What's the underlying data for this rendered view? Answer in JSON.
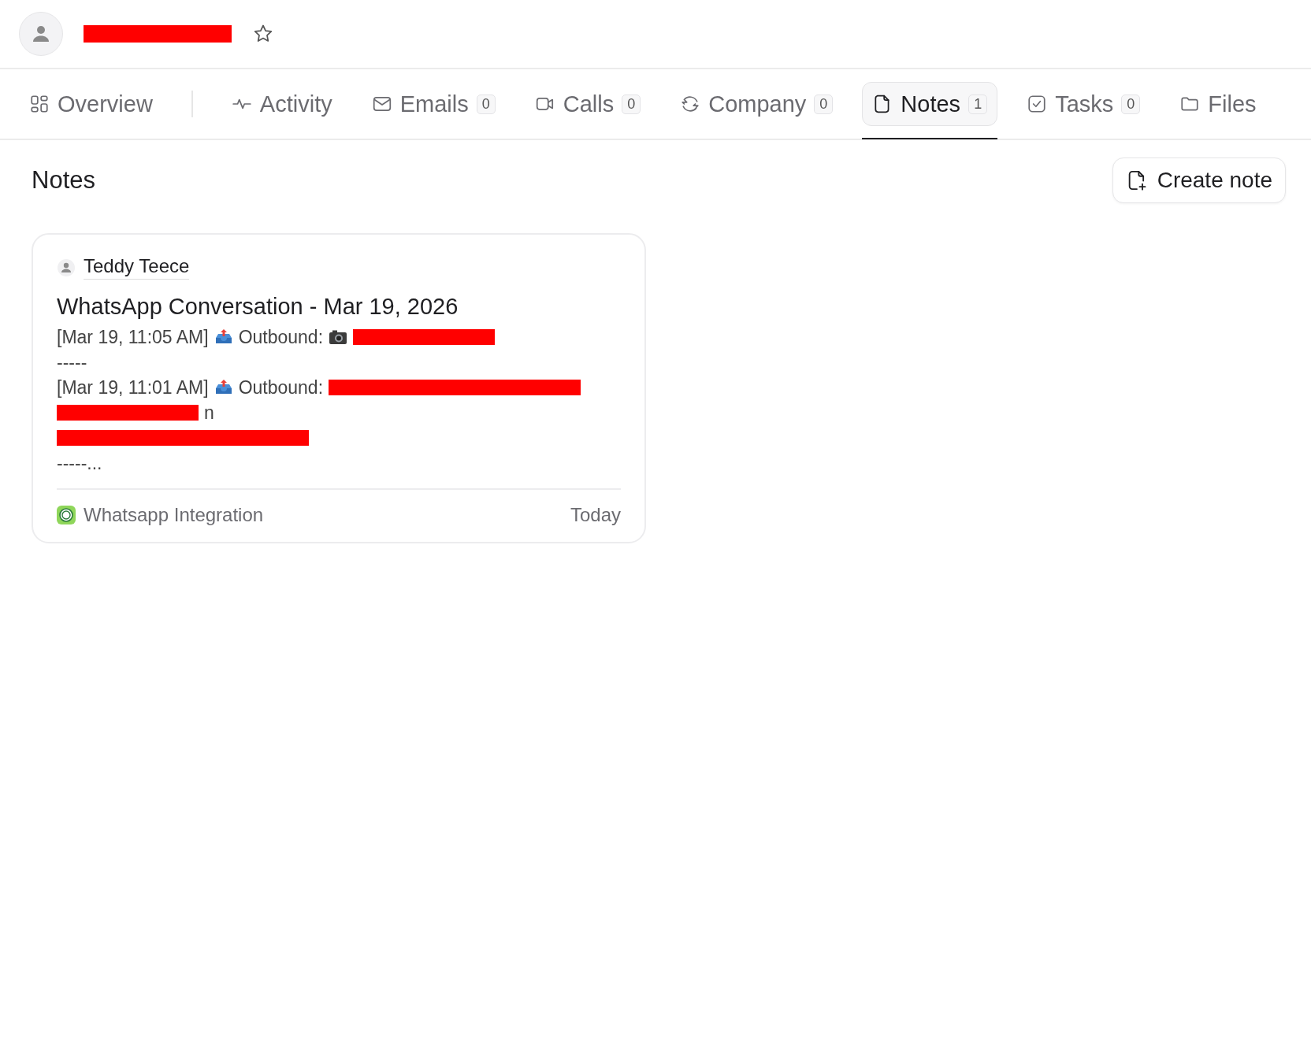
{
  "header": {
    "name": {
      "kind": "redaction"
    },
    "favorite": false
  },
  "tabs": [
    {
      "label": "Overview",
      "selected": false
    },
    {
      "label": "Activity",
      "selected": false
    },
    {
      "label": "Emails",
      "count": "0",
      "selected": false
    },
    {
      "label": "Calls",
      "count": "0",
      "selected": false
    },
    {
      "label": "Company",
      "count": "0",
      "selected": false
    },
    {
      "label": "Notes",
      "count": "1",
      "selected": true
    },
    {
      "label": "Tasks",
      "count": "0",
      "selected": false
    },
    {
      "label": "Files",
      "selected": false
    }
  ],
  "section": {
    "title": "Notes",
    "action": "Create note"
  },
  "notes": [
    {
      "author": "Teddy Teece",
      "title": "WhatsApp Conversation - Mar 19, 2026",
      "lines": [
        [
          {
            "kind": "text",
            "text": "[Mar 19, 11:05 AM]"
          },
          {
            "kind": "outbox"
          },
          {
            "kind": "text",
            "text": "Outbound:"
          },
          {
            "kind": "camera"
          },
          {
            "kind": "redaction"
          }
        ],
        [
          {
            "kind": "text",
            "text": "-----"
          }
        ],
        [
          {
            "kind": "text",
            "text": "[Mar 19, 11:01 AM]"
          },
          {
            "kind": "outbox"
          },
          {
            "kind": "text",
            "text": "Outbound:"
          },
          {
            "kind": "redaction"
          }
        ],
        [
          {
            "kind": "redaction"
          },
          {
            "kind": "text",
            "text": "n"
          }
        ],
        [
          {
            "kind": "redaction"
          }
        ],
        [
          {
            "kind": "text",
            "text": "-----..."
          }
        ]
      ],
      "source": "Whatsapp Integration",
      "date": "Today"
    }
  ]
}
